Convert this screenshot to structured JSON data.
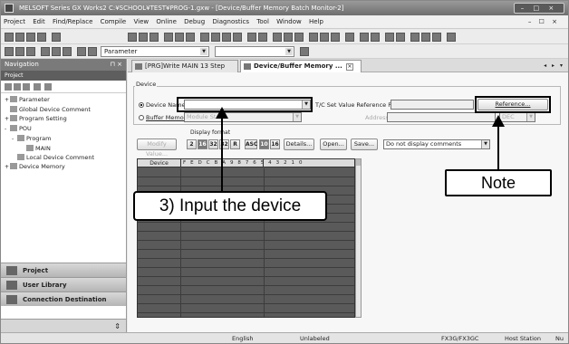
{
  "window": {
    "title": "MELSOFT Series GX Works2 C:¥SCHOOL¥TEST¥PROG-1.gxw - [Device/Buffer Memory Batch Monitor-2]",
    "controls": "– □ ×"
  },
  "menu": {
    "items": [
      "Project",
      "Edit",
      "Find/Replace",
      "Compile",
      "View",
      "Online",
      "Debug",
      "Diagnostics",
      "Tool",
      "Window",
      "Help"
    ],
    "mdi_controls": "– ☐ ×"
  },
  "toolbar": {
    "parameter_select": "Parameter"
  },
  "navigation": {
    "title": "Navigation",
    "pin": "⊓ ×",
    "section": "Project",
    "tree": [
      {
        "label": "Parameter",
        "level": 0,
        "expander": "+"
      },
      {
        "label": "Global Device Comment",
        "level": 0,
        "expander": ""
      },
      {
        "label": "Program Setting",
        "level": 0,
        "expander": "+"
      },
      {
        "label": "POU",
        "level": 0,
        "expander": "-"
      },
      {
        "label": "Program",
        "level": 1,
        "expander": "-"
      },
      {
        "label": "MAIN",
        "level": 2,
        "expander": ""
      },
      {
        "label": "Local Device Comment",
        "level": 1,
        "expander": ""
      },
      {
        "label": "Device Memory",
        "level": 0,
        "expander": "+"
      }
    ],
    "buttons": [
      "Project",
      "User Library",
      "Connection Destination"
    ],
    "footer": "⇕"
  },
  "tabs": [
    {
      "label": "[PRG]Write MAIN 13 Step",
      "active": false
    },
    {
      "label": "Device/Buffer Memory ...",
      "active": true
    }
  ],
  "tab_controls": "◂ ▸ ▾",
  "monitor": {
    "group_label": "Device",
    "device_name_label": "Device Name",
    "device_name_value": "",
    "buffer_memory_label": "Buffer Memory",
    "buffer_memory_value": "Module Start",
    "tc_label": "T/C Set Value Reference Program",
    "reference_button": "Reference...",
    "address_label": "Address",
    "address_unit": "DEC",
    "modify_button": "Modify Value...",
    "display_format_label": "Display format",
    "format_buttons": [
      "2",
      "16",
      "32",
      "32",
      "R",
      "ASC",
      "10",
      "16"
    ],
    "details_button": "Details...",
    "open_button": "Open...",
    "save_button": "Save...",
    "comment_option": "Do not display comments"
  },
  "grid": {
    "device_header": "Device",
    "bit_header": "F E D C B A 9 8 7 6 5 4 3 2 1 0",
    "row_count": 17
  },
  "status": {
    "language": "English",
    "state": "Unlabeled",
    "cpu": "FX3G/FX3GC",
    "station": "Host Station",
    "num": "Nu"
  },
  "annotations": {
    "input_device": "3) Input the device",
    "note": "Note"
  }
}
